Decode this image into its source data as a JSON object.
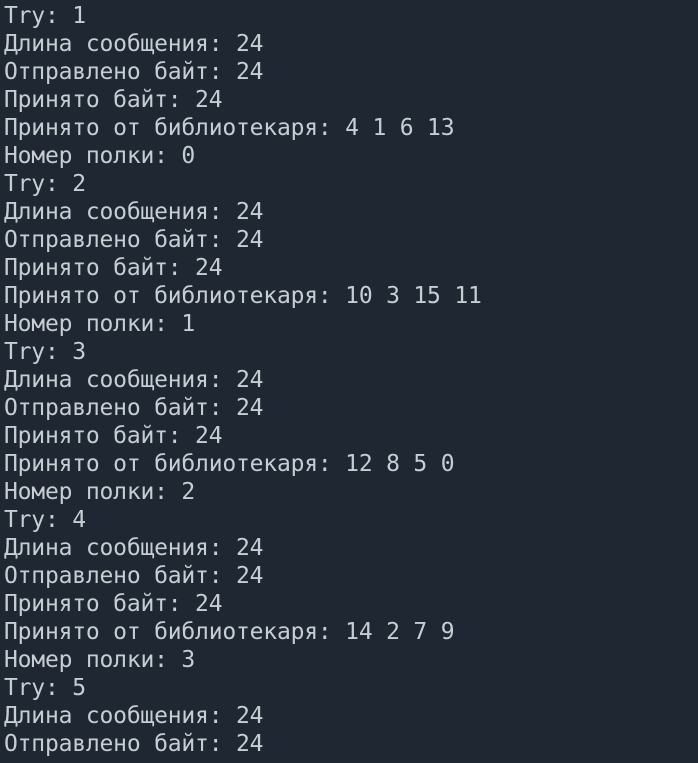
{
  "terminal": {
    "lines": [
      "Try: 1",
      "Длина сообщения: 24",
      "Отправлено байт: 24",
      "Принято байт: 24",
      "Принято от библиотекаря: 4 1 6 13",
      "Номер полки: 0",
      "Try: 2",
      "Длина сообщения: 24",
      "Отправлено байт: 24",
      "Принято байт: 24",
      "Принято от библиотекаря: 10 3 15 11",
      "Номер полки: 1",
      "Try: 3",
      "Длина сообщения: 24",
      "Отправлено байт: 24",
      "Принято байт: 24",
      "Принято от библиотекаря: 12 8 5 0",
      "Номер полки: 2",
      "Try: 4",
      "Длина сообщения: 24",
      "Отправлено байт: 24",
      "Принято байт: 24",
      "Принято от библиотекаря: 14 2 7 9",
      "Номер полки: 3",
      "Try: 5",
      "Длина сообщения: 24",
      "Отправлено байт: 24"
    ]
  }
}
